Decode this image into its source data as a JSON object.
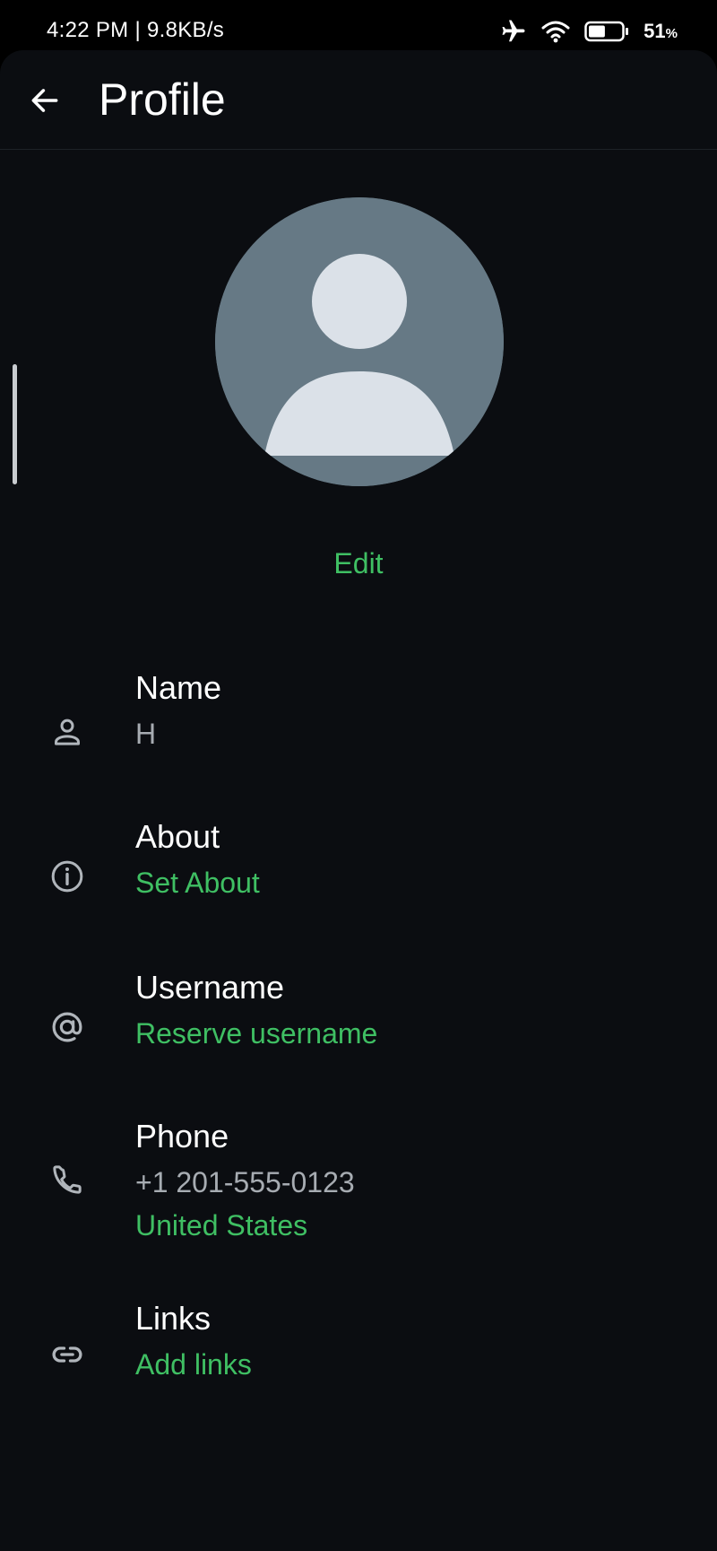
{
  "status_bar": {
    "time": "4:22 PM | 9.8KB/s",
    "battery_value": "51",
    "battery_unit": "%",
    "battery_level": 0.51,
    "icons": [
      "airplane-icon",
      "wifi-icon",
      "battery-icon"
    ]
  },
  "header": {
    "back_icon": "arrow-left-icon",
    "title": "Profile"
  },
  "avatar": {
    "icon": "default-person-avatar",
    "edit_label": "Edit"
  },
  "rows": {
    "name": {
      "icon": "person-icon",
      "title": "Name",
      "value": "H"
    },
    "about": {
      "icon": "info-icon",
      "title": "About",
      "action": "Set About"
    },
    "username": {
      "icon": "at-sign-icon",
      "title": "Username",
      "action": "Reserve username"
    },
    "phone": {
      "icon": "phone-icon",
      "title": "Phone",
      "value": "+1 201-555-0123",
      "action": "United States"
    },
    "links": {
      "icon": "link-icon",
      "title": "Links",
      "action": "Add links"
    }
  },
  "colors": {
    "background": "#0b0d11",
    "accent_green": "#3fbf63",
    "text_primary": "#ffffff",
    "text_secondary": "#a7acb2",
    "avatar_bg": "#667985",
    "avatar_figure": "#dbe1e8"
  }
}
